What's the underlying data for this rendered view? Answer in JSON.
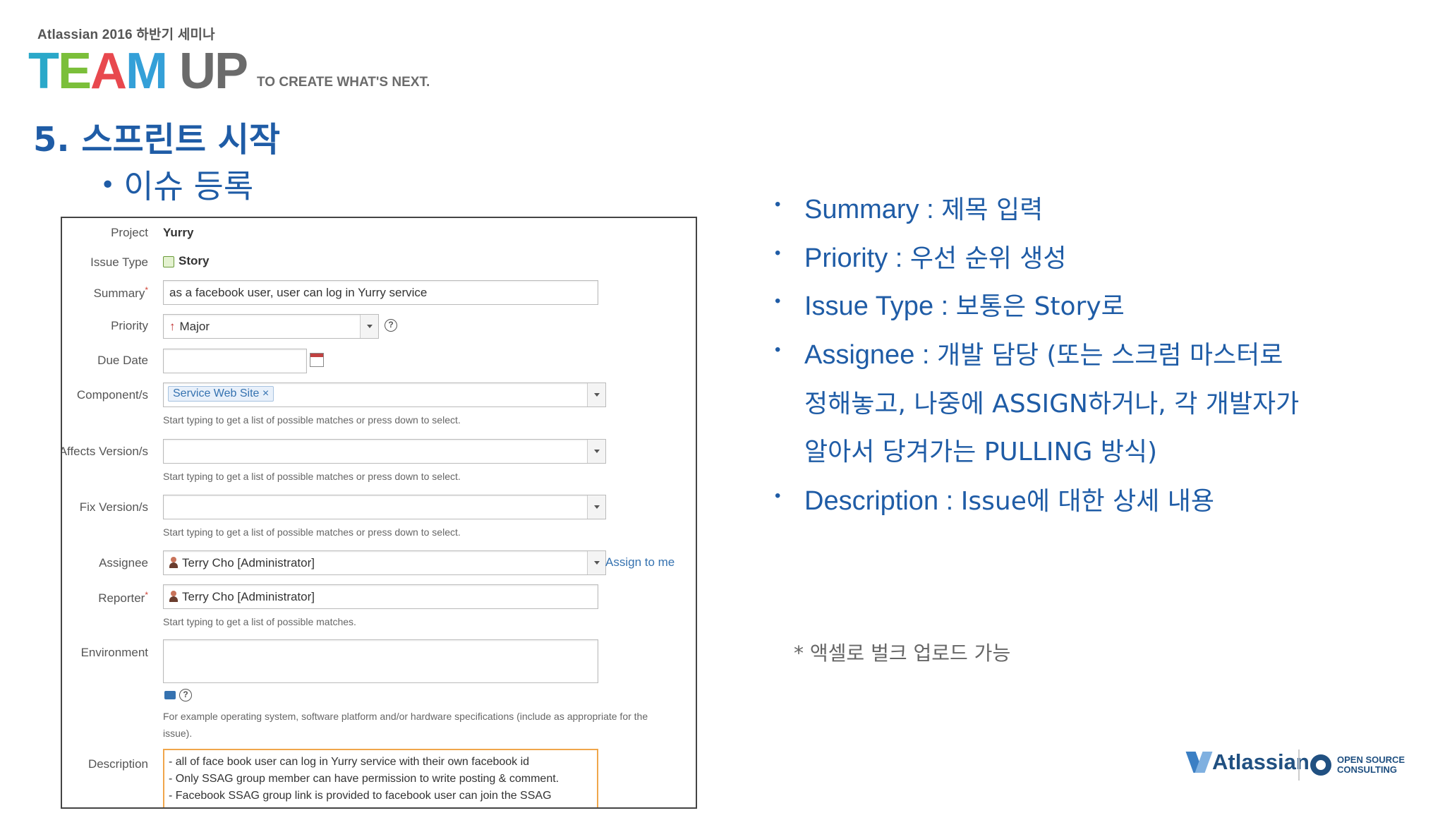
{
  "header": {
    "seminar": "Atlassian 2016 하반기 세미나",
    "logo_team": [
      "T",
      "E",
      "A",
      "M"
    ],
    "logo_up": "UP",
    "tagline": "TO CREATE WHAT'S NEXT."
  },
  "slide": {
    "title": "5. 스프린트 시작",
    "subtitle": "이슈 등록"
  },
  "form": {
    "project_label": "Project",
    "project_value": "Yurry",
    "issue_type_label": "Issue Type",
    "issue_type_value": "Story",
    "summary_label": "Summary",
    "summary_value": "as a facebook user, user can log in Yurry service",
    "priority_label": "Priority",
    "priority_value": "Major",
    "due_date_label": "Due Date",
    "due_date_value": "",
    "components_label": "Component/s",
    "components_chip": "Service Web Site",
    "components_hint": "Start typing to get a list of possible matches or press down to select.",
    "affects_label": "Affects Version/s",
    "affects_hint": "Start typing to get a list of possible matches or press down to select.",
    "fix_label": "Fix Version/s",
    "fix_hint": "Start typing to get a list of possible matches or press down to select.",
    "assignee_label": "Assignee",
    "assignee_value": "Terry Cho [Administrator]",
    "assign_to_me": "Assign to me",
    "reporter_label": "Reporter",
    "reporter_value": "Terry Cho [Administrator]",
    "reporter_hint": "Start typing to get a list of possible matches.",
    "environment_label": "Environment",
    "environment_hint_1": "For example operating system, software platform and/or hardware specifications (include as appropriate for the",
    "environment_hint_2": "issue).",
    "description_label": "Description",
    "description_lines": [
      "- all of face book user can log in Yurry service with their own facebook id",
      "- Only SSAG group member can have permission to write posting & comment.",
      "- Facebook SSAG group link is provided to facebook user can join the SSAG"
    ]
  },
  "bullets": [
    {
      "key": "Summary :",
      "text": "제목 입력"
    },
    {
      "key": "Priority :",
      "text": "우선 순위 생성"
    },
    {
      "key": "Issue Type :",
      "text": "보통은 Story로"
    },
    {
      "key": "Assignee :",
      "text": "개발 담당 (또는 스크럼 마스터로"
    },
    {
      "key": "",
      "text": "정해놓고, 나중에 ASSIGN하거나, 각 개발자가"
    },
    {
      "key": "",
      "text": "알아서 당겨가는 PULLING 방식)"
    },
    {
      "key": "Description :",
      "text": "Issue에 대한 상세 내용"
    }
  ],
  "note": "* 액셀로 벌크 업로드 가능",
  "footer": {
    "atlassian": "Atlassian",
    "osc_line1": "OPEN SOURCE",
    "osc_line2": "CONSULTING"
  },
  "colors": {
    "title_blue": "#1f5ca6",
    "link_blue": "#3572b0",
    "required_red": "#d04437",
    "description_border": "#f0a64b"
  },
  "icons": [
    "story-icon",
    "priority-major-icon",
    "help-icon",
    "calendar-icon",
    "user-icon",
    "dropdown-chevron-icon",
    "folder-icon"
  ]
}
